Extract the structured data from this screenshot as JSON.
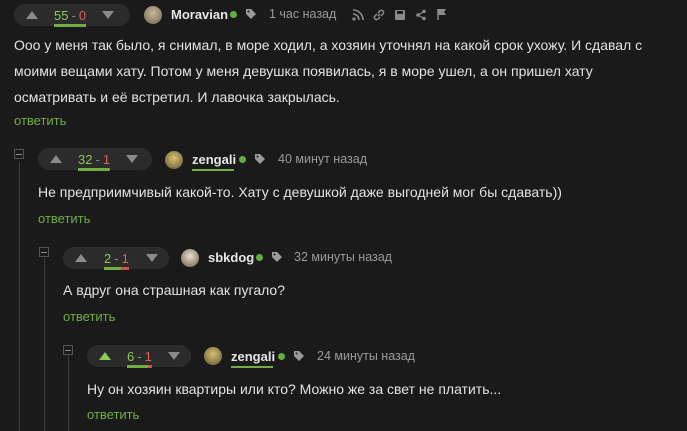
{
  "comments": [
    {
      "votes": {
        "plus": "55",
        "sep": "-",
        "minus": "0"
      },
      "vote_ratio": 1.0,
      "author": "Moravian",
      "time": "1 час назад",
      "text": "Ооо у меня так было, я снимал, в море ходил, а хозяин уточнял на какой срок ухожу. И сдавал с моими вещами хату. Потом у меня девушка появилась, я в море ушел, а он пришел хату осматривать и её встретил. И лавочка закрылась.",
      "reply_label": "ответить",
      "icons": [
        "tag-icon",
        "rss-icon",
        "link-icon",
        "save-icon",
        "share-icon",
        "flag-icon"
      ]
    },
    {
      "votes": {
        "plus": "32",
        "sep": "-",
        "minus": "1"
      },
      "vote_ratio": 0.97,
      "author": "zengali",
      "time": "40 минут назад",
      "text": "Не предприимчивый какой-то. Хату с девушкой даже выгодней мог бы сдавать))",
      "reply_label": "ответить"
    },
    {
      "votes": {
        "plus": "2",
        "sep": "-",
        "minus": "1"
      },
      "vote_ratio": 0.67,
      "author": "sbkdog",
      "time": "32 минуты назад",
      "text": "А вдруг она страшная как пугало?",
      "reply_label": "ответить"
    },
    {
      "votes": {
        "plus": "6",
        "sep": "-",
        "minus": "1"
      },
      "vote_ratio": 0.86,
      "author": "zengali",
      "time": "24 минуты назад",
      "text": "Ну он хозяин квартиры или кто? Можно же за свет не платить...",
      "reply_label": "ответить"
    }
  ],
  "colors": {
    "accent": "#6fae3f",
    "minus": "#d3514c",
    "background": "#1a1a1a"
  }
}
